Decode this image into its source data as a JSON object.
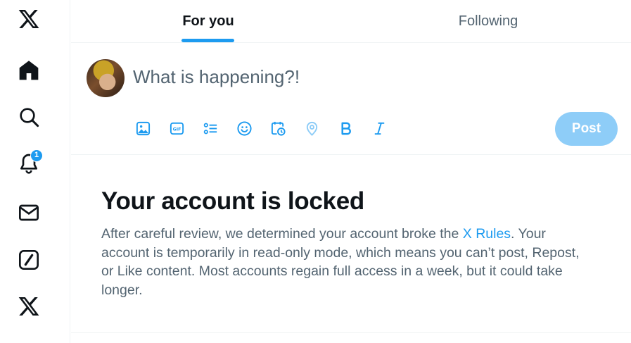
{
  "nav": {
    "notifications_badge": "1"
  },
  "tabs": {
    "for_you": "For you",
    "following": "Following"
  },
  "composer": {
    "placeholder": "What is happening?!",
    "post_label": "Post"
  },
  "notice": {
    "title": "Your account is locked",
    "body_before_link": "After careful review, we determined your account broke the ",
    "link_text": "X Rules",
    "body_after_link": ". Your account is temporarily in read-only mode, which means you can’t post, Repost, or Like content. Most accounts regain full access in a week, but it could take longer."
  },
  "colors": {
    "accent": "#1d9bf0",
    "post_disabled": "#8ecdf8",
    "text_primary": "#0f1419",
    "text_secondary": "#536471",
    "border": "#eff3f4"
  },
  "icons": {
    "nav": [
      "x-logo-icon",
      "home-icon",
      "search-icon",
      "bell-icon",
      "mail-icon",
      "grok-icon",
      "x-premium-icon"
    ],
    "composer_tools": [
      "image-icon",
      "gif-icon",
      "poll-icon",
      "emoji-icon",
      "schedule-icon",
      "location-icon",
      "bold-icon",
      "italic-icon"
    ]
  }
}
